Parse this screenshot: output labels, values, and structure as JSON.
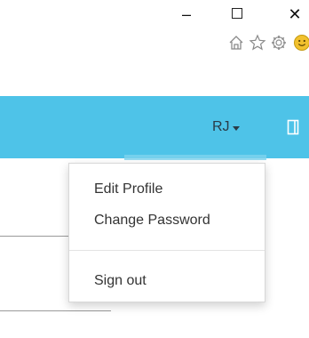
{
  "window": {
    "minimize_glyph": "–",
    "close_glyph": "✕"
  },
  "toolbar": {
    "icons": [
      "home-icon",
      "star-icon",
      "gear-icon",
      "smiley-icon"
    ]
  },
  "header": {
    "user_initials": "RJ",
    "accent_color": "#4ec3e8"
  },
  "user_menu": {
    "items": [
      {
        "label": "Edit Profile"
      },
      {
        "label": "Change Password"
      },
      {
        "label": "Sign out"
      }
    ]
  }
}
